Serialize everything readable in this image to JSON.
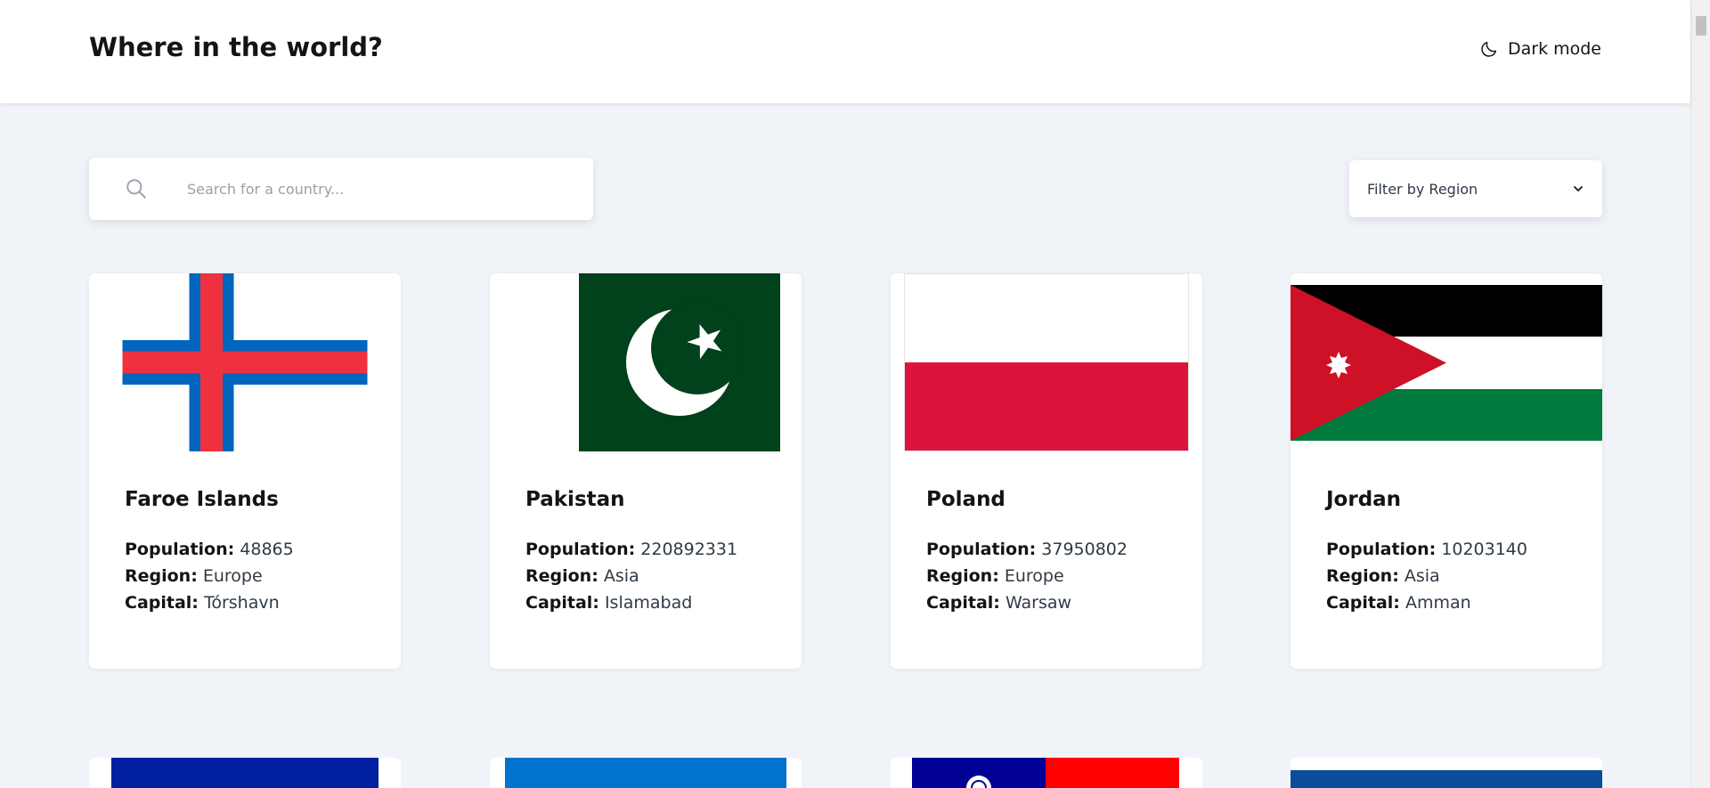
{
  "header": {
    "title": "Where in the world?",
    "theme_toggle_label": "Dark mode"
  },
  "search": {
    "placeholder": "Search for a country...",
    "value": ""
  },
  "filter": {
    "label": "Filter by Region"
  },
  "labels": {
    "population": "Population:",
    "region": "Region:",
    "capital": "Capital:"
  },
  "countries": [
    {
      "name": "Faroe Islands",
      "population": "48865",
      "region": "Europe",
      "capital": "Tórshavn",
      "flag": "faroe-islands-flag"
    },
    {
      "name": "Pakistan",
      "population": "220892331",
      "region": "Asia",
      "capital": "Islamabad",
      "flag": "pakistan-flag"
    },
    {
      "name": "Poland",
      "population": "37950802",
      "region": "Europe",
      "capital": "Warsaw",
      "flag": "poland-flag"
    },
    {
      "name": "Jordan",
      "population": "10203140",
      "region": "Asia",
      "capital": "Amman",
      "flag": "jordan-flag"
    }
  ],
  "partial_cards": [
    {
      "flag": "blue-flag"
    },
    {
      "flag": "light-blue-flag"
    },
    {
      "flag": "taiwan-flag"
    },
    {
      "flag": "blue-white-flag"
    }
  ],
  "colors": {
    "background": "#f0f3f8",
    "surface": "#ffffff",
    "text": "#111517"
  }
}
